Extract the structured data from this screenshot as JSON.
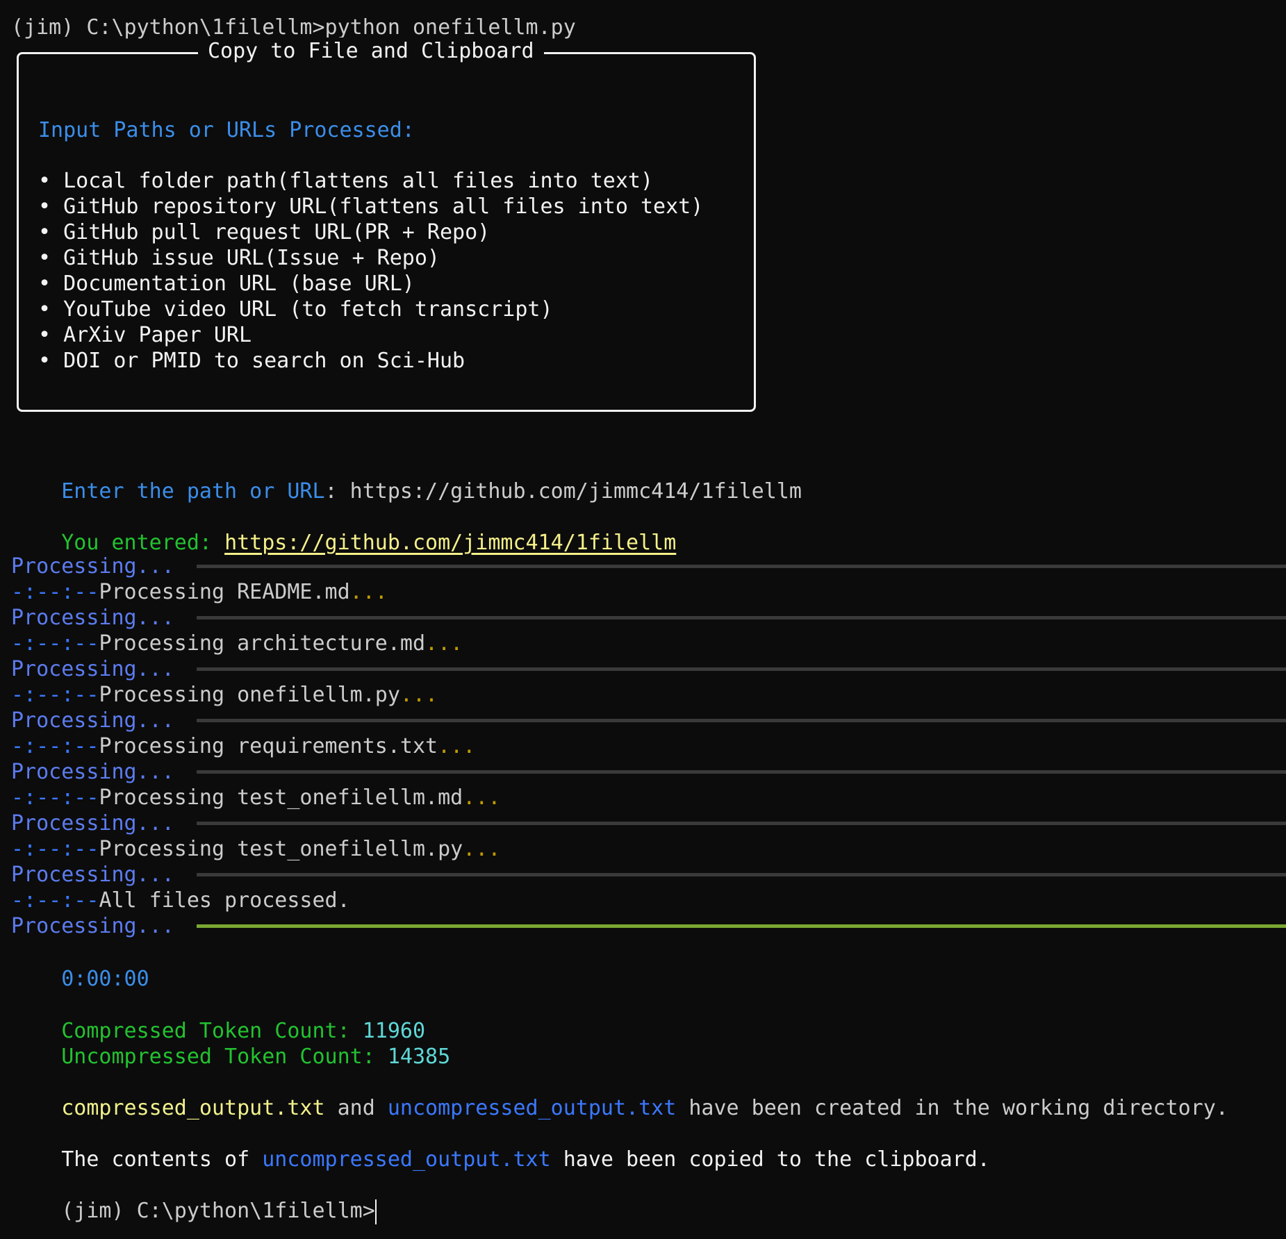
{
  "prompt": {
    "first_line": "(jim) C:\\python\\1filellm>python onefilellm.py",
    "last_line": "(jim) C:\\python\\1filellm>"
  },
  "panel": {
    "title": "Copy to File and Clipboard",
    "heading": "Input Paths or URLs Processed:",
    "items": [
      "• Local folder path(flattens all files into text)",
      "• GitHub repository URL(flattens all files into text)",
      "• GitHub pull request URL(PR + Repo)",
      "• GitHub issue URL(Issue + Repo)",
      "• Documentation URL (base URL)",
      "• YouTube video URL (to fetch transcript)",
      "• ArXiv Paper URL",
      "• DOI or PMID to search on Sci-Hub"
    ]
  },
  "input": {
    "prompt_label": "Enter the path or URL",
    "colon": ": ",
    "value": "https://github.com/jimmc414/1filellm",
    "entered_label": "You entered: ",
    "entered_value": "https://github.com/jimmc414/1filellm"
  },
  "progress": {
    "label": "Processing...",
    "time_prefix": "-:--:--",
    "dots": "...",
    "steps": [
      {
        "text": "Processing README.md",
        "dots": true
      },
      {
        "text": "Processing architecture.md",
        "dots": true
      },
      {
        "text": "Processing onefilellm.py",
        "dots": true
      },
      {
        "text": "Processing requirements.txt",
        "dots": true
      },
      {
        "text": "Processing test_onefilellm.md",
        "dots": true
      },
      {
        "text": "Processing test_onefilellm.py",
        "dots": true
      },
      {
        "text": "All files processed.",
        "dots": false
      }
    ],
    "elapsed": "0:00:00",
    "completion": 1.0
  },
  "results": {
    "compressed_label": "Compressed Token Count: ",
    "compressed_value": "11960",
    "uncompressed_label": "Uncompressed Token Count: ",
    "uncompressed_value": "14385",
    "file1": "compressed_output.txt",
    "and": " and ",
    "file2": "uncompressed_output.txt",
    "created_msg": " have been created in the working directory.",
    "contents_prefix": "The contents of ",
    "contents_file": "uncompressed_output.txt",
    "contents_suffix": " have been copied to the clipboard."
  },
  "colors": {
    "background": "#0c0c0c",
    "heading_blue": "#3b8eea",
    "green": "#23c230",
    "progress_done": "#7aa833",
    "progress_track": "#3a3a3a"
  }
}
